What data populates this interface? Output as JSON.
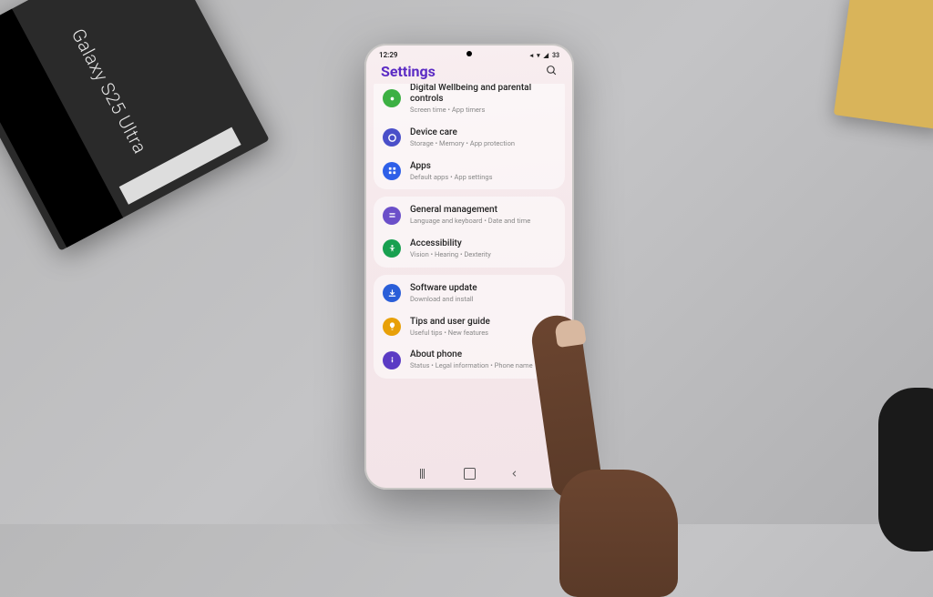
{
  "desk": {
    "box_text": "Galaxy S25 Ultra"
  },
  "status": {
    "time": "12:29",
    "battery": "33"
  },
  "header": {
    "title": "Settings"
  },
  "groups": [
    {
      "items": [
        {
          "id": "wellbeing",
          "title": "Digital Wellbeing and parental controls",
          "sub": "Screen time • App timers",
          "color": "#3cb043"
        },
        {
          "id": "device-care",
          "title": "Device care",
          "sub": "Storage • Memory • App protection",
          "color": "#4a4fc9"
        },
        {
          "id": "apps",
          "title": "Apps",
          "sub": "Default apps • App settings",
          "color": "#2e5fe8"
        }
      ]
    },
    {
      "items": [
        {
          "id": "general",
          "title": "General management",
          "sub": "Language and keyboard • Date and time",
          "color": "#6b4fc9"
        },
        {
          "id": "accessibility",
          "title": "Accessibility",
          "sub": "Vision • Hearing • Dexterity",
          "color": "#18a050"
        }
      ]
    },
    {
      "items": [
        {
          "id": "software-update",
          "title": "Software update",
          "sub": "Download and install",
          "color": "#2a5ed8"
        },
        {
          "id": "tips",
          "title": "Tips and user guide",
          "sub": "Useful tips • New features",
          "color": "#e8a008"
        },
        {
          "id": "about",
          "title": "About phone",
          "sub": "Status • Legal information • Phone name",
          "color": "#5b3bc4"
        }
      ]
    }
  ]
}
